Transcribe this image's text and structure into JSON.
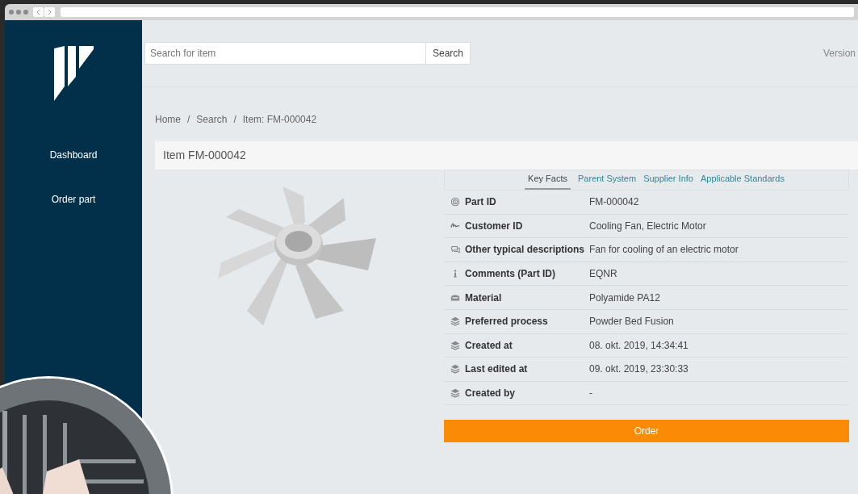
{
  "sidebar": {
    "items": [
      {
        "label": "Dashboard"
      },
      {
        "label": "Order part"
      }
    ]
  },
  "search": {
    "placeholder": "Search for item",
    "button": "Search"
  },
  "header_right": "Version",
  "breadcrumb": {
    "items": [
      "Home",
      "Search",
      "Item: FM-000042"
    ],
    "separators": [
      "/",
      "/"
    ]
  },
  "item_title": "Item FM-000042",
  "tabs": [
    {
      "label": "Key Facts",
      "selected": true
    },
    {
      "label": "Parent System",
      "selected": false
    },
    {
      "label": "Supplier Info",
      "selected": false
    },
    {
      "label": "Applicable Standards",
      "selected": false
    }
  ],
  "facts": [
    {
      "kind": "fingerprint",
      "label": "Part ID",
      "value": "FM-000042"
    },
    {
      "kind": "signature",
      "label": "Customer ID",
      "value": "Cooling Fan, Electric Motor"
    },
    {
      "kind": "chat",
      "label": "Other typical descriptions",
      "value": "Fan for cooling of an electric motor"
    },
    {
      "kind": "info",
      "label": "Comments (Part ID)",
      "value": "EQNR"
    },
    {
      "kind": "material",
      "label": "Material",
      "value": "Polyamide PA12"
    },
    {
      "kind": "layers",
      "label": "Preferred process",
      "value": "Powder Bed Fusion"
    },
    {
      "kind": "layers",
      "label": "Created at",
      "value": "08. okt. 2019, 14:34:41"
    },
    {
      "kind": "layers",
      "label": "Last edited at",
      "value": "09. okt. 2019, 23:30:33"
    },
    {
      "kind": "layers",
      "label": "Created by",
      "value": "-"
    }
  ],
  "order_button": "Order"
}
